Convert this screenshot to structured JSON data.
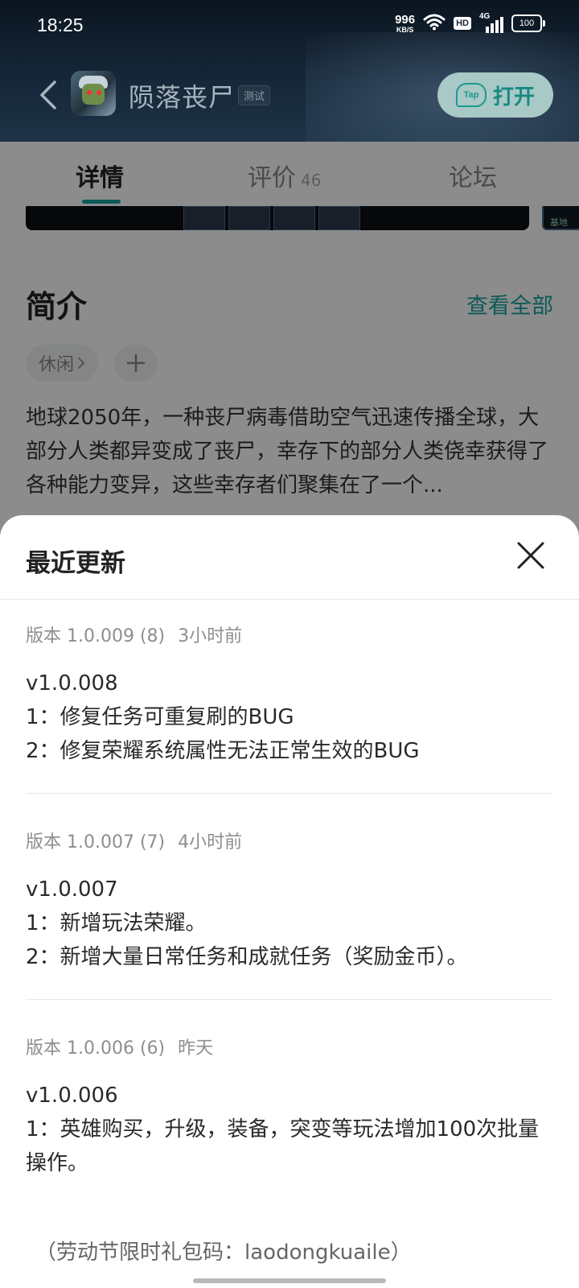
{
  "status_bar": {
    "time": "18:25",
    "net_speed_value": "996",
    "net_speed_unit": "KB/S",
    "hd_label": "HD",
    "network_type": "4G",
    "battery": "100"
  },
  "app": {
    "title": "陨落丧尸",
    "badge": "测试",
    "open_button": "打开",
    "tap_logo_text": "Tap"
  },
  "tabs": [
    {
      "label": "详情",
      "active": true
    },
    {
      "label": "评价",
      "count": "46"
    },
    {
      "label": "论坛"
    }
  ],
  "intro": {
    "screenshot_tag": "基地",
    "title": "简介",
    "see_all": "查看全部",
    "tag": "休闲",
    "description": "地球2050年，一种丧尸病毒借助空气迅速传播全球，大部分人类都异变成了丧尸，幸存下的部分人类侥幸获得了各种能力变异，这些幸存者们聚集在了一个..."
  },
  "sheet": {
    "title": "最近更新",
    "releases": [
      {
        "meta": "版本 1.0.009 (8)",
        "ago": "3小时前",
        "lines": [
          "v1.0.008",
          "1：修复任务可重复刷的BUG",
          "2：修复荣耀系统属性无法正常生效的BUG"
        ]
      },
      {
        "meta": "版本 1.0.007 (7)",
        "ago": "4小时前",
        "lines": [
          "v1.0.007",
          "1：新增玩法荣耀。",
          "2：新增大量日常任务和成就任务（奖励金币）。"
        ]
      },
      {
        "meta": "版本 1.0.006 (6)",
        "ago": "昨天",
        "lines": [
          "v1.0.006",
          "1：英雄购买，升级，装备，突变等玩法增加100次批量操作。"
        ]
      }
    ],
    "gift_code": "（劳动节限时礼包码：laodongkuaile）"
  },
  "colors": {
    "accent": "#16a5a0",
    "header_bg": "#16283a"
  }
}
